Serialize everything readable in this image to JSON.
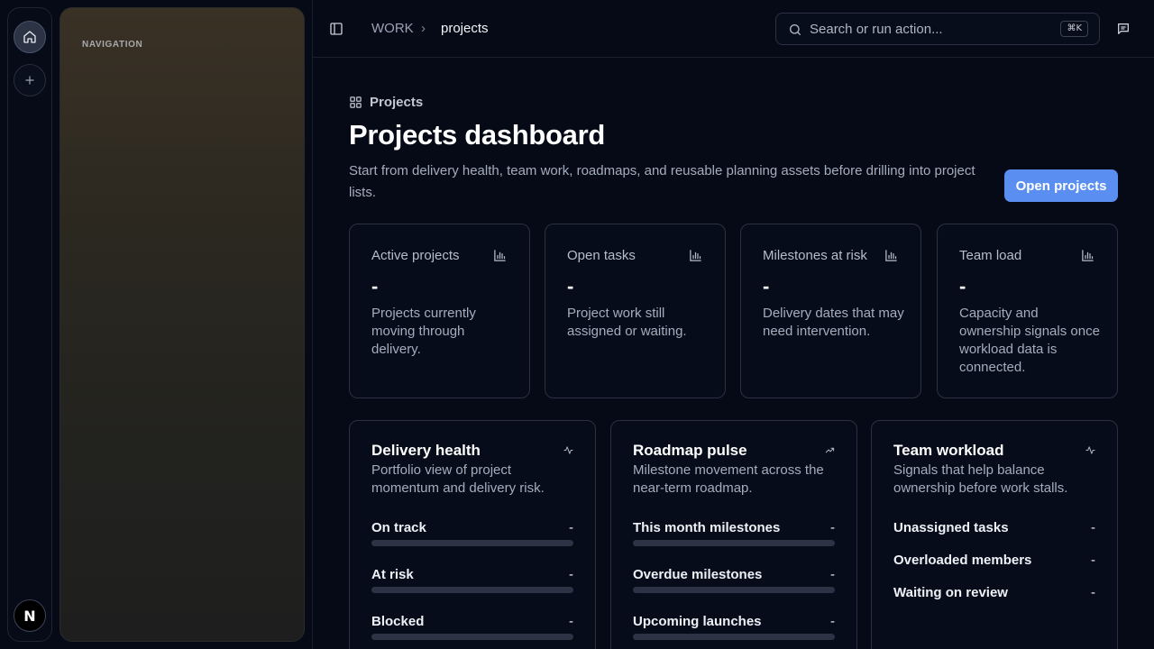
{
  "rail": {
    "home_icon": "home-icon",
    "add_icon": "plus-icon",
    "logo_letter": "N"
  },
  "nav": {
    "label": "NAVIGATION"
  },
  "topbar": {
    "breadcrumb_root": "WORK",
    "breadcrumb_separator": "›",
    "breadcrumb_current": "projects",
    "search_placeholder": "Search or run action...",
    "search_shortcut": "⌘K"
  },
  "header": {
    "eyebrow": "Projects",
    "title": "Projects dashboard",
    "subtitle": "Start from delivery health, team work, roadmaps, and reusable planning assets before drilling into project lists.",
    "primary_button": "Open projects"
  },
  "stats": [
    {
      "label": "Active projects",
      "value": "-",
      "description": "Projects currently moving through delivery."
    },
    {
      "label": "Open tasks",
      "value": "-",
      "description": "Project work still assigned or waiting."
    },
    {
      "label": "Milestones at risk",
      "value": "-",
      "description": "Delivery dates that may need intervention."
    },
    {
      "label": "Team load",
      "value": "-",
      "description": "Capacity and ownership signals once workload data is connected."
    }
  ],
  "panels": [
    {
      "title": "Delivery health",
      "description": "Portfolio view of project momentum and delivery risk.",
      "icon": "activity-icon",
      "metrics": [
        {
          "label": "On track",
          "value": "-",
          "progress": 0
        },
        {
          "label": "At risk",
          "value": "-",
          "progress": 0
        },
        {
          "label": "Blocked",
          "value": "-",
          "progress": 0
        }
      ]
    },
    {
      "title": "Roadmap pulse",
      "description": "Milestone movement across the near-term roadmap.",
      "icon": "trending-up-icon",
      "metrics": [
        {
          "label": "This month milestones",
          "value": "-",
          "progress": 0
        },
        {
          "label": "Overdue milestones",
          "value": "-",
          "progress": 0
        },
        {
          "label": "Upcoming launches",
          "value": "-",
          "progress": 0
        }
      ]
    },
    {
      "title": "Team workload",
      "description": "Signals that help balance ownership before work stalls.",
      "icon": "activity-icon",
      "metrics": [
        {
          "label": "Unassigned tasks",
          "value": "-"
        },
        {
          "label": "Overloaded members",
          "value": "-"
        },
        {
          "label": "Waiting on review",
          "value": "-"
        }
      ]
    }
  ],
  "colors": {
    "accent": "#5a8ef0",
    "background": "#060a17",
    "card_border": "#2a3142"
  }
}
